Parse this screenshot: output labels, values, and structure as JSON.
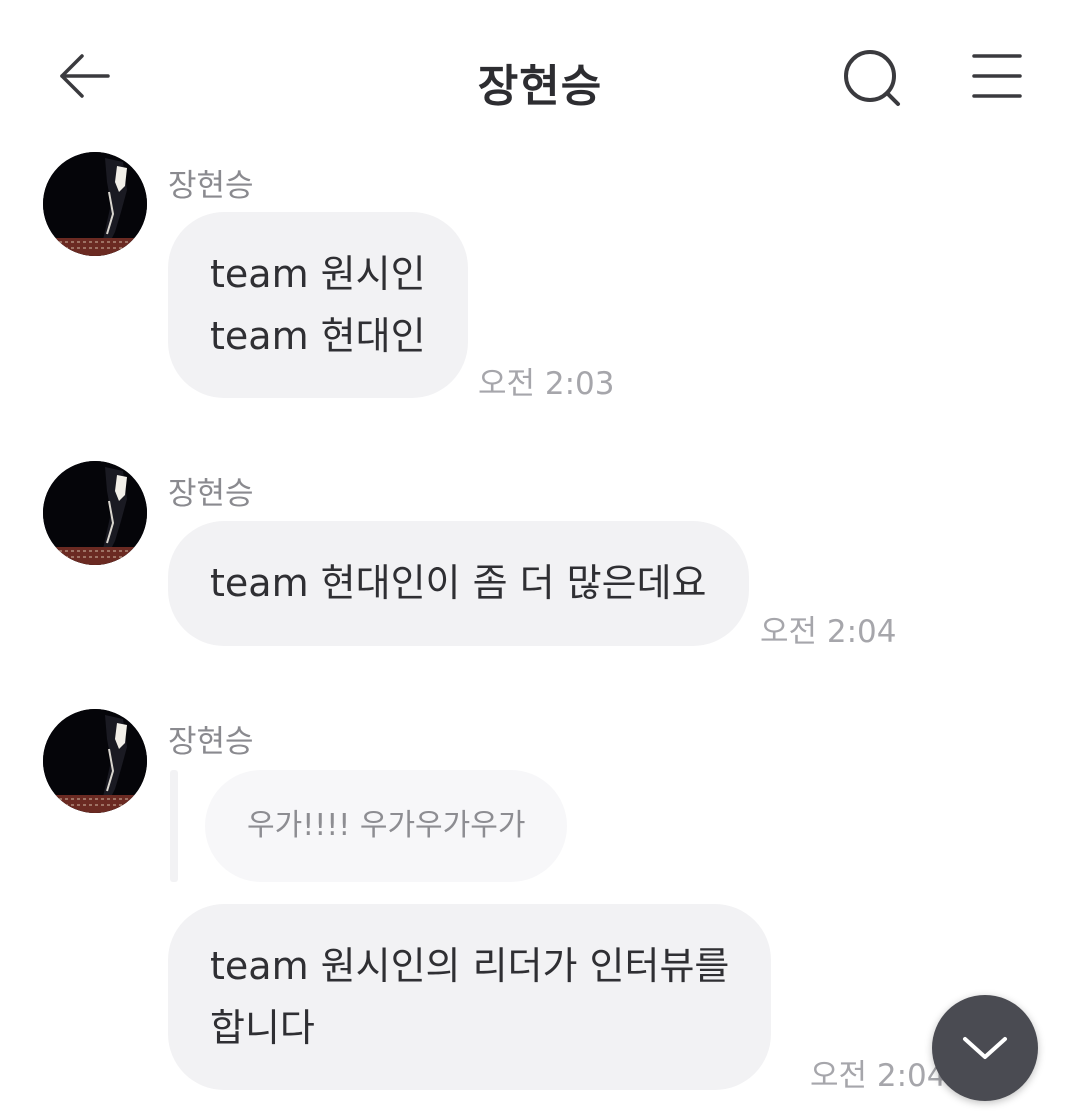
{
  "header": {
    "title": "장현승",
    "back_icon": "arrow-left-icon",
    "search_icon": "search-icon",
    "menu_icon": "hamburger-menu-icon"
  },
  "messages": [
    {
      "sender": "장현승",
      "text": "team 원시인\nteam 현대인",
      "time": "오전 2:03"
    },
    {
      "sender": "장현승",
      "text": "team 현대인이 좀 더 많은데요",
      "time": "오전 2:04"
    },
    {
      "sender": "장현승",
      "quote": "우가!!!! 우가우가우가",
      "text": "team 원시인의 리더가 인터뷰를\n합니다",
      "time": "오전 2:04"
    }
  ],
  "scroll_button_icon": "chevron-down-icon",
  "colors": {
    "bubble": "#f2f2f4",
    "quote_bubble": "#f7f7f9",
    "scroll_button": "#4a4b52",
    "text": "#2f2f33",
    "time": "#a6a6ab"
  }
}
